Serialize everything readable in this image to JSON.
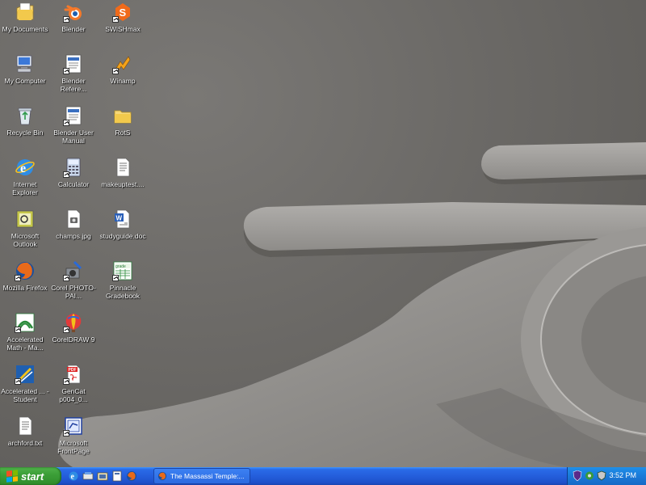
{
  "desktop": {
    "icons": [
      {
        "label": "My Documents",
        "icon": "my-documents-icon",
        "shortcut": false
      },
      {
        "label": "My Computer",
        "icon": "my-computer-icon",
        "shortcut": false
      },
      {
        "label": "Recycle Bin",
        "icon": "recycle-bin-icon",
        "shortcut": false
      },
      {
        "label": "Internet Explorer",
        "icon": "internet-explorer-icon",
        "shortcut": false
      },
      {
        "label": "Microsoft Outlook",
        "icon": "outlook-icon",
        "shortcut": false
      },
      {
        "label": "Mozilla Firefox",
        "icon": "firefox-icon",
        "shortcut": true
      },
      {
        "label": "Accelerated Math - Ma...",
        "icon": "accelerated-math-icon",
        "shortcut": true
      },
      {
        "label": "Accelerated ... - Student",
        "icon": "accelerated-student-icon",
        "shortcut": true
      },
      {
        "label": "archford.txt",
        "icon": "text-file-icon",
        "shortcut": false
      },
      {
        "label": "Blender",
        "icon": "blender-icon",
        "shortcut": true
      },
      {
        "label": "Blender Refere...",
        "icon": "blender-reference-icon",
        "shortcut": true
      },
      {
        "label": "Blender User Manual",
        "icon": "blender-manual-icon",
        "shortcut": true
      },
      {
        "label": "Calculator",
        "icon": "calculator-icon",
        "shortcut": true
      },
      {
        "label": "champs.jpg",
        "icon": "image-file-icon",
        "shortcut": false
      },
      {
        "label": "Corel PHOTO-PAI...",
        "icon": "corel-photopaint-icon",
        "shortcut": true
      },
      {
        "label": "CorelDRAW 9",
        "icon": "coreldraw-icon",
        "shortcut": true
      },
      {
        "label": "GenCat p004_0...",
        "icon": "pdf-file-icon",
        "shortcut": true
      },
      {
        "label": "Microsoft FrontPage",
        "icon": "frontpage-icon",
        "shortcut": true
      },
      {
        "label": "SWiSHmax",
        "icon": "swishmax-icon",
        "shortcut": true
      },
      {
        "label": "Winamp",
        "icon": "winamp-icon",
        "shortcut": true
      },
      {
        "label": "RotS",
        "icon": "folder-icon",
        "shortcut": false
      },
      {
        "label": "makeuptest....",
        "icon": "text-file-icon",
        "shortcut": false
      },
      {
        "label": "studyguide.doc",
        "icon": "word-doc-icon",
        "shortcut": false
      },
      {
        "label": "Pinnacle Gradebook",
        "icon": "gradebook-icon",
        "shortcut": true
      }
    ]
  },
  "taskbar": {
    "start_label": "start",
    "quick_launch": [
      "internet-explorer-icon",
      "show-desktop-icon",
      "media-icon",
      "outlook-express-icon",
      "firefox-icon"
    ],
    "task_item_label": "The Massassi Temple:...",
    "tray_icons": [
      "antivirus-icon",
      "network-icon",
      "security-icon"
    ],
    "clock": "3:52 PM"
  },
  "colors": {
    "taskbar_blue": "#245edb",
    "start_green": "#3c9f38",
    "tray_blue": "#1a7ad8",
    "wallpaper_gray": "#6b6966"
  }
}
